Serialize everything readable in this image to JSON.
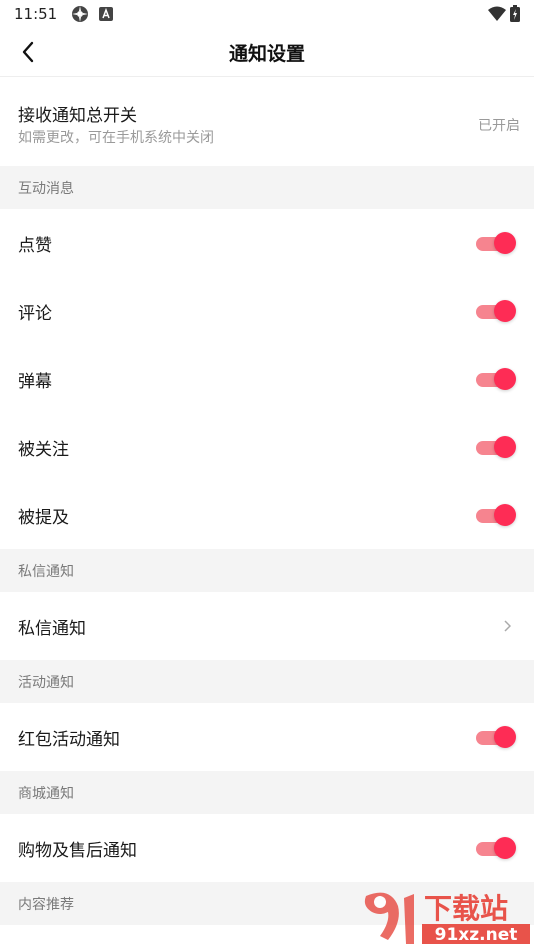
{
  "status_bar": {
    "time": "11:51"
  },
  "header": {
    "title": "通知设置"
  },
  "master": {
    "label": "接收通知总开关",
    "sub": "如需更改，可在手机系统中关闭",
    "status": "已开启"
  },
  "sections": {
    "interaction": "互动消息",
    "private": "私信通知",
    "activity": "活动通知",
    "mall": "商城通知",
    "recommend": "内容推荐"
  },
  "rows": {
    "like": {
      "label": "点赞",
      "on": true
    },
    "comment": {
      "label": "评论",
      "on": true
    },
    "danmaku": {
      "label": "弹幕",
      "on": true
    },
    "followed": {
      "label": "被关注",
      "on": true
    },
    "mentioned": {
      "label": "被提及",
      "on": true
    },
    "private_msg": {
      "label": "私信通知"
    },
    "red_packet": {
      "label": "红包活动通知",
      "on": true
    },
    "shopping": {
      "label": "购物及售后通知",
      "on": true
    }
  },
  "watermark": {
    "brand": "下载站",
    "domain": "91xz.net"
  },
  "colors": {
    "accent": "#fe2c55",
    "track": "#f6848f",
    "section_bg": "#f4f4f4"
  }
}
